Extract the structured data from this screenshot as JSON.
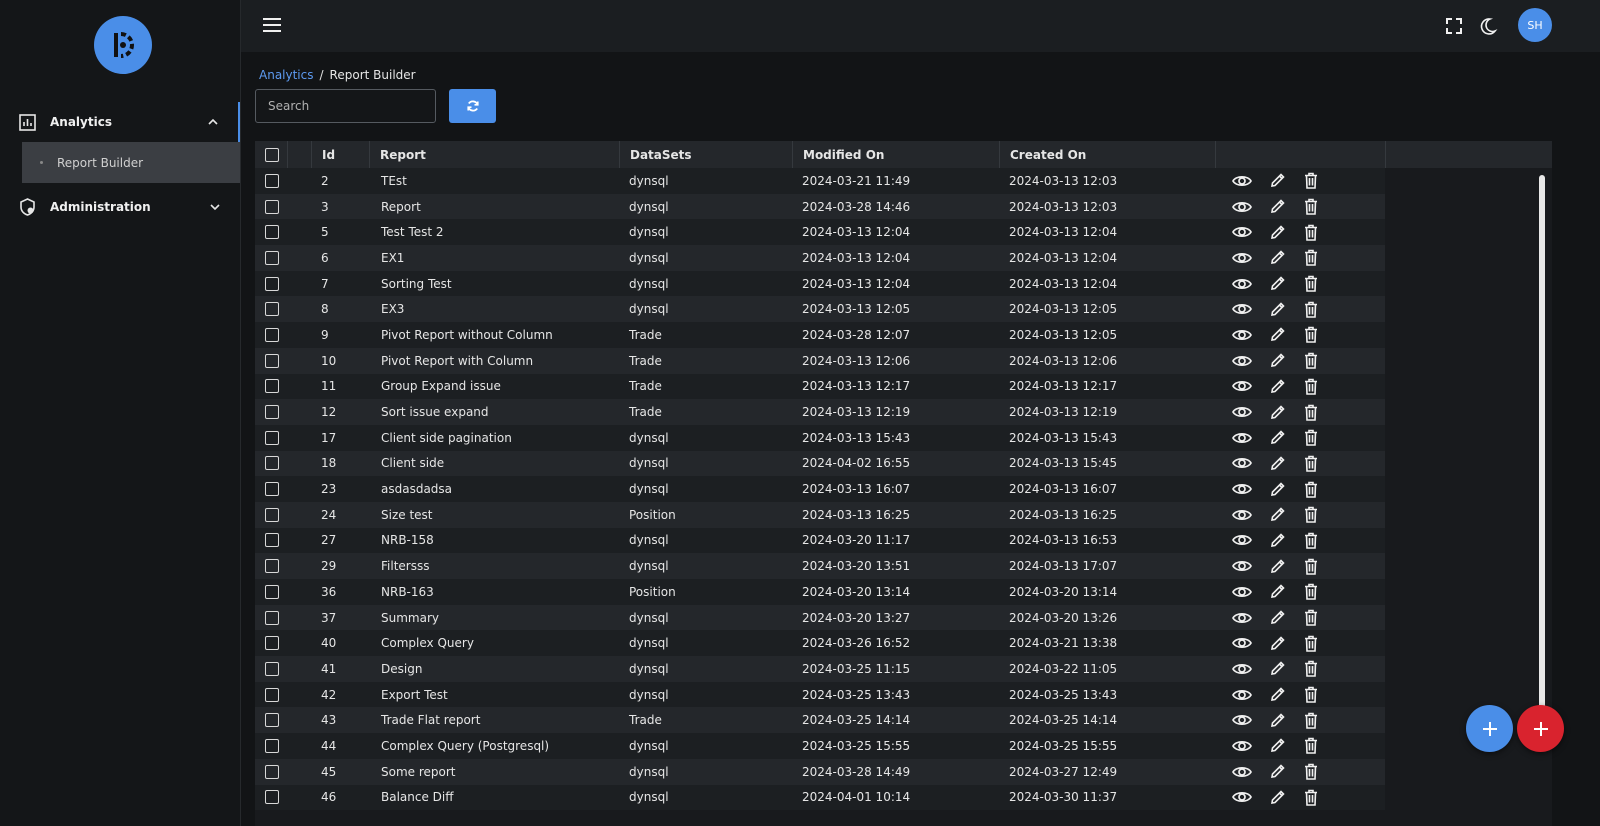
{
  "sidebar": {
    "items": [
      {
        "label": "Analytics",
        "icon": "chart-icon",
        "expanded": true
      },
      {
        "label": "Administration",
        "icon": "shield-icon",
        "expanded": false
      }
    ],
    "subitems": [
      {
        "label": "Report Builder"
      }
    ]
  },
  "header": {
    "avatar_initials": "SH"
  },
  "breadcrumb": {
    "parent": "Analytics",
    "separator": "/",
    "current": "Report Builder"
  },
  "search": {
    "placeholder": "Search",
    "value": ""
  },
  "table": {
    "columns": [
      "Id",
      "Report",
      "DataSets",
      "Modified On",
      "Created On"
    ],
    "rows": [
      {
        "id": "2",
        "report": "TEst",
        "dataset": "dynsql",
        "modified": "2024-03-21 11:49",
        "created": "2024-03-13 12:03"
      },
      {
        "id": "3",
        "report": "Report",
        "dataset": "dynsql",
        "modified": "2024-03-28 14:46",
        "created": "2024-03-13 12:03"
      },
      {
        "id": "5",
        "report": "Test Test 2",
        "dataset": "dynsql",
        "modified": "2024-03-13 12:04",
        "created": "2024-03-13 12:04"
      },
      {
        "id": "6",
        "report": "EX1",
        "dataset": "dynsql",
        "modified": "2024-03-13 12:04",
        "created": "2024-03-13 12:04"
      },
      {
        "id": "7",
        "report": "Sorting Test",
        "dataset": "dynsql",
        "modified": "2024-03-13 12:04",
        "created": "2024-03-13 12:04"
      },
      {
        "id": "8",
        "report": "EX3",
        "dataset": "dynsql",
        "modified": "2024-03-13 12:05",
        "created": "2024-03-13 12:05"
      },
      {
        "id": "9",
        "report": "Pivot Report without Column",
        "dataset": "Trade",
        "modified": "2024-03-28 12:07",
        "created": "2024-03-13 12:05"
      },
      {
        "id": "10",
        "report": "Pivot Report with Column",
        "dataset": "Trade",
        "modified": "2024-03-13 12:06",
        "created": "2024-03-13 12:06"
      },
      {
        "id": "11",
        "report": "Group Expand issue",
        "dataset": "Trade",
        "modified": "2024-03-13 12:17",
        "created": "2024-03-13 12:17"
      },
      {
        "id": "12",
        "report": "Sort issue expand",
        "dataset": "Trade",
        "modified": "2024-03-13 12:19",
        "created": "2024-03-13 12:19"
      },
      {
        "id": "17",
        "report": "Client side pagination",
        "dataset": "dynsql",
        "modified": "2024-03-13 15:43",
        "created": "2024-03-13 15:43"
      },
      {
        "id": "18",
        "report": "Client side",
        "dataset": "dynsql",
        "modified": "2024-04-02 16:55",
        "created": "2024-03-13 15:45"
      },
      {
        "id": "23",
        "report": "asdasdadsa",
        "dataset": "dynsql",
        "modified": "2024-03-13 16:07",
        "created": "2024-03-13 16:07"
      },
      {
        "id": "24",
        "report": "Size test",
        "dataset": "Position",
        "modified": "2024-03-13 16:25",
        "created": "2024-03-13 16:25"
      },
      {
        "id": "27",
        "report": "NRB-158",
        "dataset": "dynsql",
        "modified": "2024-03-20 11:17",
        "created": "2024-03-13 16:53"
      },
      {
        "id": "29",
        "report": "Filtersss",
        "dataset": "dynsql",
        "modified": "2024-03-20 13:51",
        "created": "2024-03-13 17:07"
      },
      {
        "id": "36",
        "report": "NRB-163",
        "dataset": "Position",
        "modified": "2024-03-20 13:14",
        "created": "2024-03-20 13:14"
      },
      {
        "id": "37",
        "report": "Summary",
        "dataset": "dynsql",
        "modified": "2024-03-20 13:27",
        "created": "2024-03-20 13:26"
      },
      {
        "id": "40",
        "report": "Complex Query",
        "dataset": "dynsql",
        "modified": "2024-03-26 16:52",
        "created": "2024-03-21 13:38"
      },
      {
        "id": "41",
        "report": "Design",
        "dataset": "dynsql",
        "modified": "2024-03-25 11:15",
        "created": "2024-03-22 11:05"
      },
      {
        "id": "42",
        "report": "Export Test",
        "dataset": "dynsql",
        "modified": "2024-03-25 13:43",
        "created": "2024-03-25 13:43"
      },
      {
        "id": "43",
        "report": "Trade Flat report",
        "dataset": "Trade",
        "modified": "2024-03-25 14:14",
        "created": "2024-03-25 14:14"
      },
      {
        "id": "44",
        "report": "Complex Query (Postgresql)",
        "dataset": "dynsql",
        "modified": "2024-03-25 15:55",
        "created": "2024-03-25 15:55"
      },
      {
        "id": "45",
        "report": "Some report",
        "dataset": "dynsql",
        "modified": "2024-03-28 14:49",
        "created": "2024-03-27 12:49"
      },
      {
        "id": "46",
        "report": "Balance Diff",
        "dataset": "dynsql",
        "modified": "2024-04-01 10:14",
        "created": "2024-03-30 11:37"
      }
    ]
  },
  "colors": {
    "accent": "#4a8ee8",
    "danger": "#d9232e",
    "background": "#121416"
  }
}
